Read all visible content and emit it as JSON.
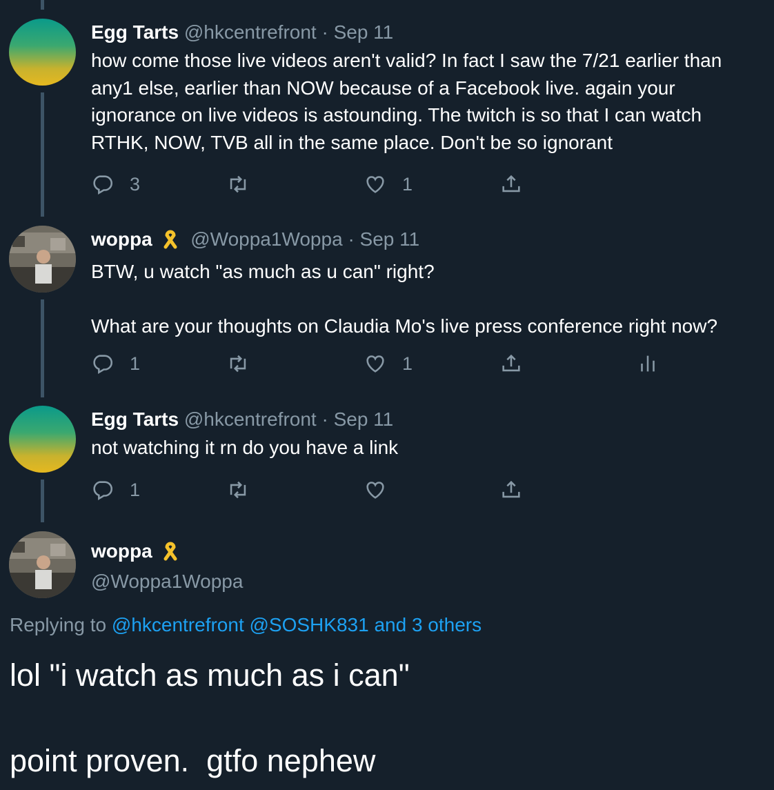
{
  "tweets": [
    {
      "name": "Egg Tarts",
      "handle": "@hkcentrefront",
      "separator": "·",
      "date": "Sep 11",
      "text": "how come those live videos aren't valid? In fact I saw the 7/21 earlier than any1 else, earlier than NOW because of a Facebook live. again your ignorance on live videos is astounding. The twitch is so that I can watch RTHK, NOW, TVB all in the same place. Don't be so ignorant",
      "reply_count": "3",
      "retweet_count": "",
      "like_count": "1"
    },
    {
      "name": "woppa",
      "handle": "@Woppa1Woppa",
      "separator": "·",
      "date": "Sep 11",
      "text": "BTW, u watch \"as much as u can\" right?\n\nWhat are your thoughts on Claudia Mo's live press conference right now?",
      "reply_count": "1",
      "retweet_count": "",
      "like_count": "1"
    },
    {
      "name": "Egg Tarts",
      "handle": "@hkcentrefront",
      "separator": "·",
      "date": "Sep 11",
      "text": "not watching it rn do you have a link",
      "reply_count": "1",
      "retweet_count": "",
      "like_count": ""
    }
  ],
  "main_tweet": {
    "name": "woppa",
    "handle": "@Woppa1Woppa",
    "replying_label": "Replying to",
    "reply_targets": [
      "@hkcentrefront",
      "@SOSHK831",
      "and 3 others"
    ],
    "text": "lol \"i watch as much as i can\"\n\npoint proven.  gtfo nephew"
  },
  "colors": {
    "background": "#15202b",
    "secondary_text": "#8899a6",
    "link": "#1da1f2",
    "ribbon": "#f5c22b",
    "thread_line": "#3d5466"
  },
  "icons": [
    "reply-icon",
    "retweet-icon",
    "like-icon",
    "share-icon",
    "analytics-icon",
    "yellow-ribbon-icon"
  ]
}
